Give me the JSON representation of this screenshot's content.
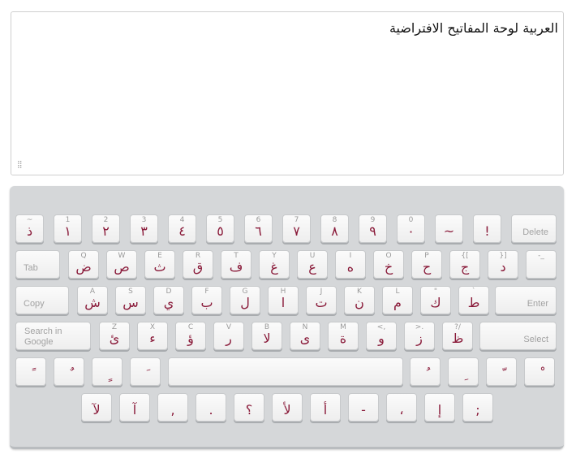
{
  "editor": {
    "text": "العربية لوحة المفاتيح الافتراضية",
    "resize_glyph": "⣿"
  },
  "rows": {
    "r1": [
      {
        "lat": "~",
        "ar": "ذ"
      },
      {
        "lat": "1",
        "ar": "١"
      },
      {
        "lat": "2",
        "ar": "٢"
      },
      {
        "lat": "3",
        "ar": "٣"
      },
      {
        "lat": "4",
        "ar": "٤"
      },
      {
        "lat": "5",
        "ar": "٥"
      },
      {
        "lat": "6",
        "ar": "٦"
      },
      {
        "lat": "7",
        "ar": "٧"
      },
      {
        "lat": "8",
        "ar": "٨"
      },
      {
        "lat": "9",
        "ar": "٩"
      },
      {
        "lat": "0",
        "ar": "٠"
      },
      {
        "lat": "",
        "ar": "~"
      },
      {
        "lat": "",
        "ar": "!"
      }
    ],
    "r2": [
      {
        "lat": "Q",
        "ar": "ض"
      },
      {
        "lat": "W",
        "ar": "ص"
      },
      {
        "lat": "E",
        "ar": "ث"
      },
      {
        "lat": "R",
        "ar": "ق"
      },
      {
        "lat": "T",
        "ar": "ف"
      },
      {
        "lat": "Y",
        "ar": "غ"
      },
      {
        "lat": "U",
        "ar": "ع"
      },
      {
        "lat": "I",
        "ar": "ه"
      },
      {
        "lat": "O",
        "ar": "خ"
      },
      {
        "lat": "P",
        "ar": "ح"
      },
      {
        "lat": "{[",
        "ar": "ج"
      },
      {
        "lat": "}]",
        "ar": "د"
      },
      {
        "lat": "-_",
        "ar": ""
      }
    ],
    "r3": [
      {
        "lat": "A",
        "ar": "ش"
      },
      {
        "lat": "S",
        "ar": "س"
      },
      {
        "lat": "D",
        "ar": "ي"
      },
      {
        "lat": "F",
        "ar": "ب"
      },
      {
        "lat": "G",
        "ar": "ل"
      },
      {
        "lat": "H",
        "ar": "ا"
      },
      {
        "lat": "J",
        "ar": "ت"
      },
      {
        "lat": "K",
        "ar": "ن"
      },
      {
        "lat": "L",
        "ar": "م"
      },
      {
        "lat": "\"",
        "ar": "ك"
      },
      {
        "lat": "`",
        "ar": "ط"
      }
    ],
    "r4": [
      {
        "lat": "Z",
        "ar": "ئ"
      },
      {
        "lat": "X",
        "ar": "ء"
      },
      {
        "lat": "C",
        "ar": "ؤ"
      },
      {
        "lat": "V",
        "ar": "ر"
      },
      {
        "lat": "B",
        "ar": "لا"
      },
      {
        "lat": "N",
        "ar": "ى"
      },
      {
        "lat": "M",
        "ar": "ة"
      },
      {
        "lat": "<,",
        "ar": "و"
      },
      {
        "lat": ">.",
        "ar": "ز"
      },
      {
        "lat": "?/",
        "ar": "ظ"
      }
    ],
    "r5_left": [
      {
        "lat": "",
        "ar": "ً"
      },
      {
        "lat": "",
        "ar": "ٌ"
      },
      {
        "lat": "",
        "ar": "ٍ"
      },
      {
        "lat": "",
        "ar": "َ"
      }
    ],
    "r5_right": [
      {
        "lat": "",
        "ar": "ُ"
      },
      {
        "lat": "",
        "ar": "ِ"
      },
      {
        "lat": "",
        "ar": "ّ"
      },
      {
        "lat": "",
        "ar": "ْ"
      }
    ],
    "r6": [
      {
        "lat": "",
        "ar": "لآ"
      },
      {
        "lat": "",
        "ar": "آ"
      },
      {
        "lat": "",
        "ar": ","
      },
      {
        "lat": "",
        "ar": "."
      },
      {
        "lat": "",
        "ar": "؟"
      },
      {
        "lat": "",
        "ar": "لأ"
      },
      {
        "lat": "",
        "ar": "أ"
      },
      {
        "lat": "",
        "ar": "-"
      },
      {
        "lat": "",
        "ar": "،"
      },
      {
        "lat": "",
        "ar": "إ"
      },
      {
        "lat": "",
        "ar": ";"
      }
    ]
  },
  "controls": {
    "delete": "Delete",
    "tab": "Tab",
    "copy": "Copy",
    "enter": "Enter",
    "search_line1": "Search in",
    "search_line2": "Google",
    "select": "Select",
    "space": ""
  }
}
